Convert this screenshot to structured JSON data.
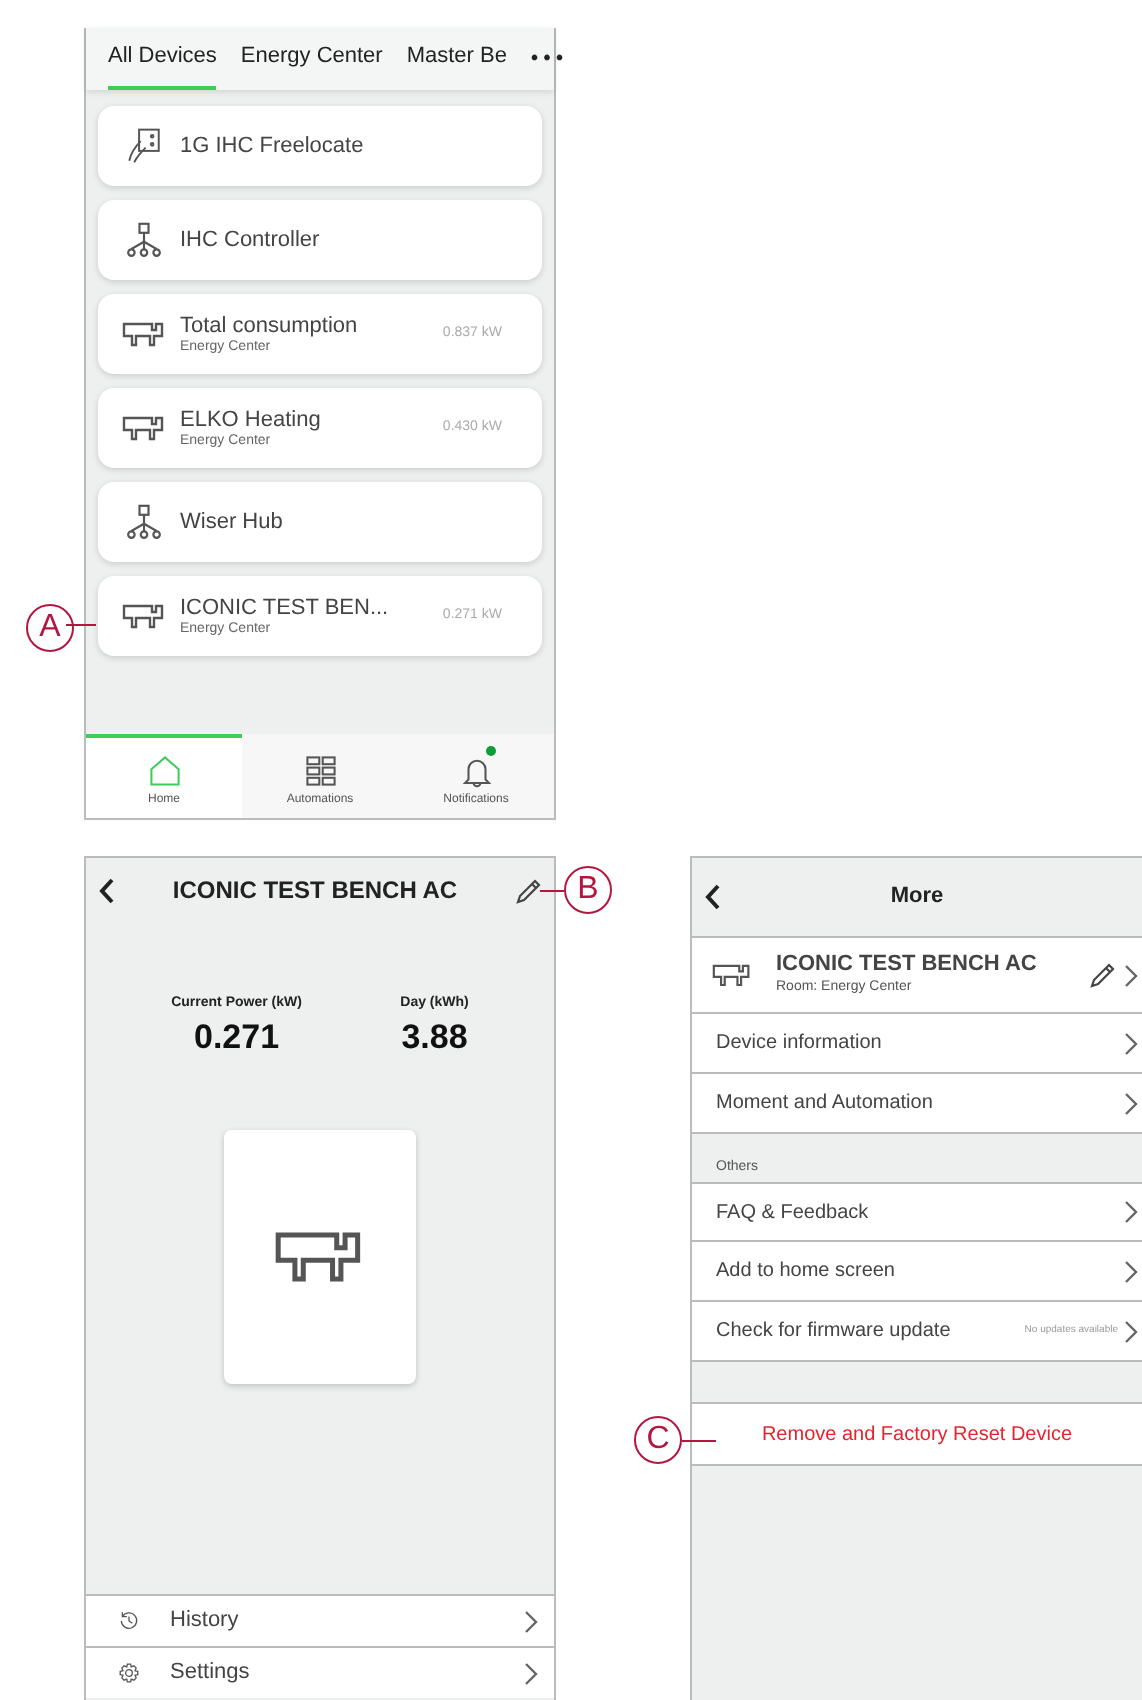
{
  "home_screen": {
    "tabs": [
      {
        "label": "All Devices",
        "selected": true
      },
      {
        "label": "Energy Center",
        "selected": false
      },
      {
        "label": "Master Be",
        "selected": false
      }
    ],
    "more_tabs": "• • •",
    "devices": [
      {
        "kind": "touchpanel",
        "name": "1G IHC Freelocate"
      },
      {
        "kind": "hub",
        "name": "IHC Controller"
      },
      {
        "kind": "meter",
        "name": "Total consumption",
        "room": "Energy Center",
        "reading": "0.837 kW"
      },
      {
        "kind": "meter",
        "name": "ELKO Heating",
        "room": "Energy Center",
        "reading": "0.430 kW"
      },
      {
        "kind": "hub",
        "name": "Wiser Hub"
      },
      {
        "kind": "meter",
        "name": "ICONIC TEST BEN...",
        "room": "Energy Center",
        "reading": "0.271 kW"
      }
    ],
    "nav": [
      {
        "kind": "home",
        "label": "Home",
        "selected": true,
        "badge": false
      },
      {
        "kind": "automations",
        "label": "Automations",
        "selected": false,
        "badge": false
      },
      {
        "kind": "notifications",
        "label": "Notifications",
        "selected": false,
        "badge": true
      }
    ]
  },
  "device_screen": {
    "title": "ICONIC TEST BENCH AC",
    "stats": [
      {
        "label": "Current Power (kW)",
        "value": "0.271"
      },
      {
        "label": "Day (kWh)",
        "value": "3.88"
      }
    ],
    "menu": [
      {
        "kind": "history",
        "label": "History"
      },
      {
        "kind": "settings",
        "label": "Settings"
      }
    ]
  },
  "more_screen": {
    "title": "More",
    "device": {
      "name": "ICONIC TEST BENCH AC",
      "room": "Room: Energy Center"
    },
    "items": [
      {
        "label": "Device information"
      },
      {
        "label": "Moment and Automation"
      }
    ],
    "section_label": "Others",
    "other_items": [
      {
        "label": "FAQ & Feedback"
      },
      {
        "label": "Add to home screen"
      },
      {
        "label": "Check for firmware update",
        "note": "No updates available"
      }
    ],
    "danger_action": "Remove and Factory Reset Device"
  },
  "callouts": [
    {
      "letter": "A"
    },
    {
      "letter": "B"
    },
    {
      "letter": "C"
    }
  ]
}
